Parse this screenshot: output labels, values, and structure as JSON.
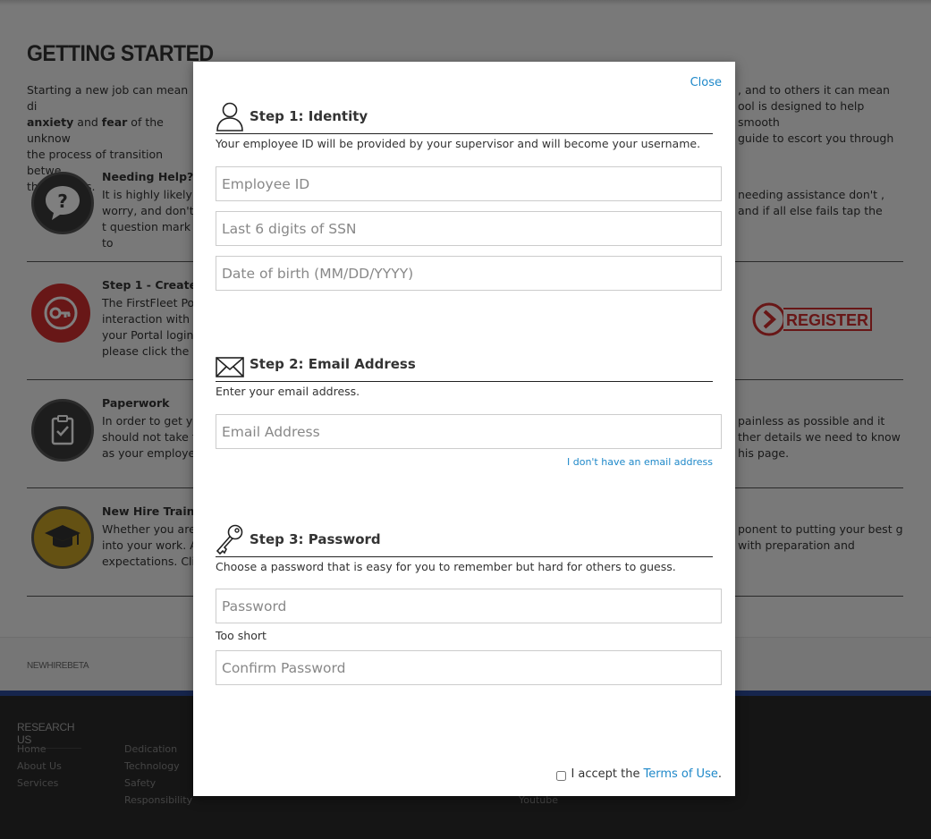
{
  "background": {
    "title": "GETTING STARTED",
    "intro": {
      "left_lines": [
        "Starting a new job can mean di",
        "anxiety",
        "and",
        "fear",
        "of the unknow",
        "the process of transition betwe",
        "the process."
      ],
      "right_lines": [
        ", and to others it can mean",
        "ool is designed to help smooth",
        "guide to escort you through"
      ]
    },
    "sections": [
      {
        "title": "Needing Help?",
        "text": "It is highly likely t worry, and don't t question mark to",
        "right": "needing assistance don't , and if all else fails tap the"
      },
      {
        "title": "Step 1 - Create Lo",
        "text": "The FirstFleet Po interaction with p your Portal login please click the R",
        "right": ""
      },
      {
        "title": "Paperwork",
        "text": "In order to get yo should not take t as your employe",
        "right": "painless as possible and it ther details we need to know his page."
      },
      {
        "title": "New Hire Trainin",
        "text": "Whether you are into your work. A expectations. Cli",
        "right": "ponent to putting your best g with preparation and"
      }
    ],
    "register_label": "REGISTER",
    "footer_brand": "NEWHIREBETA",
    "footer_heading": "RESEARCH US",
    "footer_col1": [
      "Home",
      "About Us",
      "Services"
    ],
    "footer_col2": [
      "Dedication",
      "Technology",
      "Safety",
      "Responsibility"
    ],
    "footer_col3_partial": "Youtube"
  },
  "modal": {
    "close_label": "Close",
    "step1": {
      "title": "Step 1: Identity",
      "description": "Your employee ID will be provided by your supervisor and will become your username.",
      "employee_id_placeholder": "Employee ID",
      "ssn_placeholder": "Last 6 digits of SSN",
      "dob_placeholder": "Date of birth (MM/DD/YYYY)"
    },
    "step2": {
      "title": "Step 2: Email Address",
      "description": "Enter your email address.",
      "email_placeholder": "Email Address",
      "no_email_link": "I don't have an email address"
    },
    "step3": {
      "title": "Step 3: Password",
      "description": "Choose a password that is easy for you to remember but hard for others to guess.",
      "password_placeholder": "Password",
      "strength_text": "Too short",
      "confirm_placeholder": "Confirm Password"
    },
    "terms": {
      "prefix": "I accept the",
      "link": "Terms of Use",
      "suffix": "."
    }
  },
  "colors": {
    "link": "#1e88c9",
    "footer_blue": "#2d4a9a",
    "help_icon": "#3a3a3a",
    "login_icon": "#d12f2f",
    "training_icon": "#c9a227"
  }
}
